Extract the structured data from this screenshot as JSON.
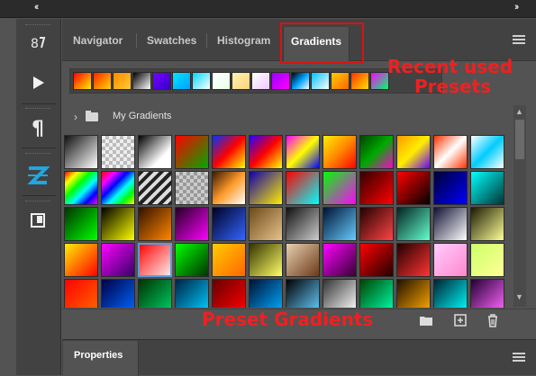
{
  "topbar": {
    "collapse_left": "‹‹",
    "collapse_right": "››"
  },
  "toolstrip": {
    "tools": [
      {
        "name": "history-brush-icon",
        "glyph": "⇅"
      },
      {
        "name": "actions-play-icon",
        "glyph": "▶"
      },
      {
        "name": "paragraph-icon",
        "glyph": "¶"
      },
      {
        "name": "glyph-z-icon",
        "glyph": "Z"
      },
      {
        "name": "libraries-icon",
        "glyph": "◧"
      }
    ],
    "z_color": "#1fa7e0"
  },
  "tabs": {
    "navigator": "Navigator",
    "swatches": "Swatches",
    "histogram": "Histogram",
    "gradients": "Gradients"
  },
  "annotations": {
    "recent_line1": "Recent used",
    "recent_line2": "Presets",
    "preset_gradients": "Preset Gradients",
    "color": "#f02020"
  },
  "recent_presets": [
    "linear-gradient(135deg,#ff0000,#ffee00)",
    "linear-gradient(135deg,#ff2200,#ffd800)",
    "linear-gradient(135deg,#ff8800,#ffcc33)",
    "linear-gradient(135deg,#000000,#ffffff)",
    "linear-gradient(135deg,#7a00ff,#3300cc)",
    "linear-gradient(135deg,#00e5ff,#00a0ff)",
    "linear-gradient(135deg,#00d8ff,#ffffff)",
    "linear-gradient(135deg,#ffffff,#e6ffe6)",
    "linear-gradient(135deg,#fff2b0,#ffd27a)",
    "linear-gradient(135deg,#ffffff,#f0c8ff)",
    "linear-gradient(135deg,#9b00ff,#ff00ff)",
    "linear-gradient(135deg,#000000,#00a0ff,#ffffff)",
    "linear-gradient(135deg,#00c0ff,#ffffff)",
    "linear-gradient(135deg,#ffcc00,#ff6600)",
    "linear-gradient(135deg,#ff3300,#ffe000)",
    "linear-gradient(135deg,#ff00ff,#00ff66)"
  ],
  "my_gradients": {
    "label": "My Gradients"
  },
  "presets": [
    "linear-gradient(135deg,#111,#fff)",
    "repeating-conic-gradient(#bbb 0 25%,#eee 0 50%) 0 0/8px 8px",
    "linear-gradient(135deg,#000,#fff 70%)",
    "linear-gradient(135deg,#ff0000,#00aa00)",
    "linear-gradient(135deg,#0033ff,#ff0000,#ffff00)",
    "linear-gradient(135deg,#2200ff,#ff0000,#ffff00)",
    "linear-gradient(135deg,#ff00ff,#ffff00 50%,#0000ff)",
    "linear-gradient(135deg,#ffee00,#ff8800,#ff0000)",
    "linear-gradient(135deg,#004400,#00aa00,#ff00cc)",
    "linear-gradient(135deg,#ff9900,#ffee00 50%,#6600ff)",
    "linear-gradient(135deg,#ff3300,#ffffff 50%,#ff3300)",
    "linear-gradient(135deg,#ffffff,#00ccff 50%,#ffffff)",
    "linear-gradient(135deg,#ff0000,#ffff00,#00ff00,#00ffff,#0000ff,#ff00ff)",
    "linear-gradient(135deg,#ff0000,#ff00ff,#0000ff,#00ffff,#00ff00,#ffff00)",
    "repeating-linear-gradient(135deg,#222 0 4px,#ddd 4px 8px)",
    "repeating-conic-gradient(#999 0 25%,#ccc 0 50%) 0 0/8px 8px",
    "linear-gradient(135deg,#3a1a00,#ff9a2a,#ffffff)",
    "linear-gradient(135deg,#1100aa,#ffee00)",
    "linear-gradient(135deg,#ff0000,#00ffff)",
    "linear-gradient(135deg,#00ff00,#ff00ff)",
    "linear-gradient(135deg,#330000,#ff0000)",
    "linear-gradient(135deg,#ff0000,#000000)",
    "linear-gradient(135deg,#000033,#0000ff)",
    "linear-gradient(135deg,#00ffff,#003333)",
    "linear-gradient(135deg,#003300,#00ff00)",
    "linear-gradient(135deg,#000000,#ffff00)",
    "linear-gradient(135deg,#331100,#ff8800)",
    "linear-gradient(135deg,#220022,#ff00ff)",
    "linear-gradient(135deg,#000022,#3366ff)",
    "linear-gradient(135deg,#6b4a1a,#e8c28a)",
    "linear-gradient(135deg,#111111,#cccccc)",
    "linear-gradient(135deg,#001133,#66ccff)",
    "linear-gradient(135deg,#220000,#ff4444)",
    "linear-gradient(135deg,#002222,#66ffcc)",
    "linear-gradient(135deg,#111133,#ffffff)",
    "linear-gradient(135deg,#1a1a00,#ffff99)",
    "linear-gradient(135deg,#ffee00,#ff0000)",
    "linear-gradient(135deg,#ff00ff,#330066)",
    "linear-gradient(135deg,#ff0000,#ffeeee)",
    "linear-gradient(135deg,#00ff00,#003300)",
    "linear-gradient(135deg,#ffcc00,#ff6600)",
    "linear-gradient(135deg,#333300,#ffff66)",
    "linear-gradient(135deg,#e8d0b0,#6b3a1a)",
    "linear-gradient(135deg,#ff00ff,#330033)",
    "linear-gradient(135deg,#ff0000,#220000)",
    "linear-gradient(135deg,#220000,#ff3333)",
    "linear-gradient(135deg,#ffccff,#ff88cc)",
    "linear-gradient(135deg,#ccff66,#ffff99)",
    "linear-gradient(135deg,#ff0000,#ff6600)",
    "linear-gradient(135deg,#000044,#0066ff)",
    "linear-gradient(135deg,#003300,#00cc66)",
    "linear-gradient(135deg,#002244,#00ccff)",
    "linear-gradient(135deg,#660000,#ff0000)",
    "linear-gradient(135deg,#001133,#00aaff)",
    "linear-gradient(135deg,#000000,#66ccff)",
    "linear-gradient(135deg,#333333,#ffffff)",
    "linear-gradient(135deg,#004400,#00ffaa)",
    "linear-gradient(135deg,#221100,#ffaa00)",
    "linear-gradient(135deg,#002233,#00ffff)",
    "linear-gradient(135deg,#220033,#ff66ff)"
  ],
  "footer": {
    "new_folder_icon": "folder-icon",
    "new_preset_icon": "add-icon",
    "delete_icon": "trash-icon"
  },
  "properties": {
    "tab": "Properties"
  },
  "colors": {
    "panel_bg": "#535353",
    "tab_bg": "#424242",
    "selection": "#5a9ad8"
  }
}
